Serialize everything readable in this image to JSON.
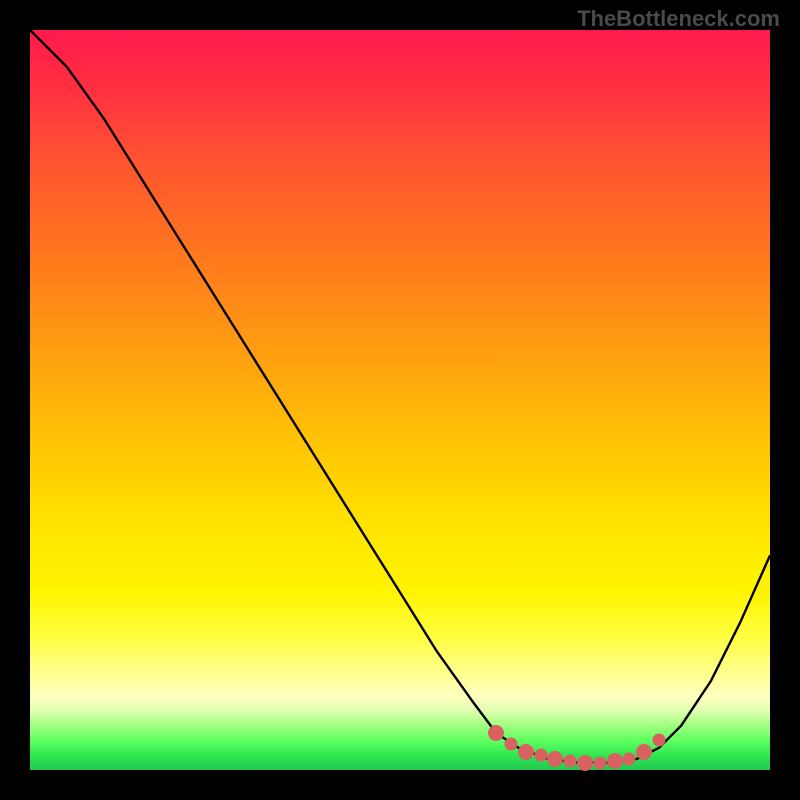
{
  "watermark": "TheBottleneck.com",
  "chart_data": {
    "type": "line",
    "title": "",
    "xlabel": "",
    "ylabel": "",
    "xlim": [
      0,
      100
    ],
    "ylim": [
      0,
      100
    ],
    "series": [
      {
        "name": "bottleneck-curve",
        "x": [
          0,
          5,
          10,
          15,
          20,
          25,
          30,
          35,
          40,
          45,
          50,
          55,
          60,
          63,
          66,
          70,
          74,
          78,
          82,
          85,
          88,
          92,
          96,
          100
        ],
        "y": [
          100,
          95,
          88,
          80,
          72,
          64,
          56,
          48,
          40,
          32,
          24,
          16,
          9,
          5,
          3,
          1.5,
          1,
          1,
          1.5,
          3,
          6,
          12,
          20,
          29
        ]
      }
    ],
    "markers": {
      "name": "optimal-range-markers",
      "points": [
        {
          "x": 63,
          "y": 5
        },
        {
          "x": 65,
          "y": 3.5
        },
        {
          "x": 67,
          "y": 2.5
        },
        {
          "x": 69,
          "y": 2
        },
        {
          "x": 71,
          "y": 1.5
        },
        {
          "x": 73,
          "y": 1.2
        },
        {
          "x": 75,
          "y": 1
        },
        {
          "x": 77,
          "y": 1
        },
        {
          "x": 79,
          "y": 1.2
        },
        {
          "x": 81,
          "y": 1.5
        },
        {
          "x": 83,
          "y": 2.5
        },
        {
          "x": 85,
          "y": 4
        }
      ]
    },
    "gradient_meaning": "red-high-bottleneck to green-low-bottleneck"
  }
}
